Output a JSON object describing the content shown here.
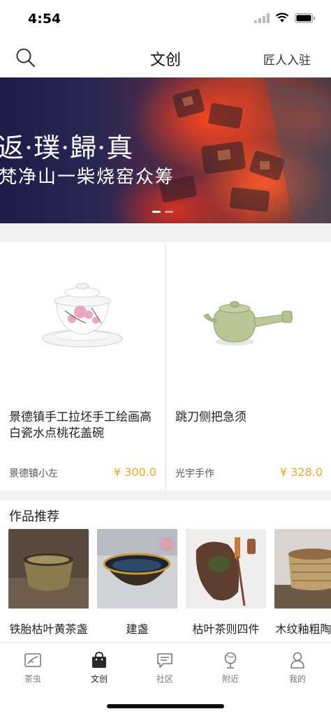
{
  "status_bar": {
    "time": "4:54"
  },
  "nav": {
    "title": "文创",
    "right_link": "匠人入驻"
  },
  "banner": {
    "title_line1": "返·璞·歸·真",
    "title_line2": "梵净山一柴烧窑众筹"
  },
  "products": [
    {
      "name": "景德镇手工拉坯手工绘画高白瓷水点桃花盖碗",
      "shop": "景德镇小左",
      "price": "¥ 300.0"
    },
    {
      "name": "跳刀侧把急须",
      "shop": "光宇手作",
      "price": "¥ 328.0"
    }
  ],
  "works": {
    "section_title": "作品推荐",
    "items": [
      {
        "name": "铁胎枯叶黄茶盏"
      },
      {
        "name": "建盏"
      },
      {
        "name": "枯叶茶则四件"
      },
      {
        "name": "木纹釉粗陶道杯"
      }
    ]
  },
  "tabs": [
    {
      "label": "茶虫",
      "icon": "tea-bug-icon"
    },
    {
      "label": "文创",
      "icon": "bag-icon",
      "active": true
    },
    {
      "label": "社区",
      "icon": "chat-icon"
    },
    {
      "label": "附近",
      "icon": "location-icon"
    },
    {
      "label": "我的",
      "icon": "person-icon"
    }
  ],
  "colors": {
    "price": "#f5a623",
    "accent_dark": "#222222"
  }
}
